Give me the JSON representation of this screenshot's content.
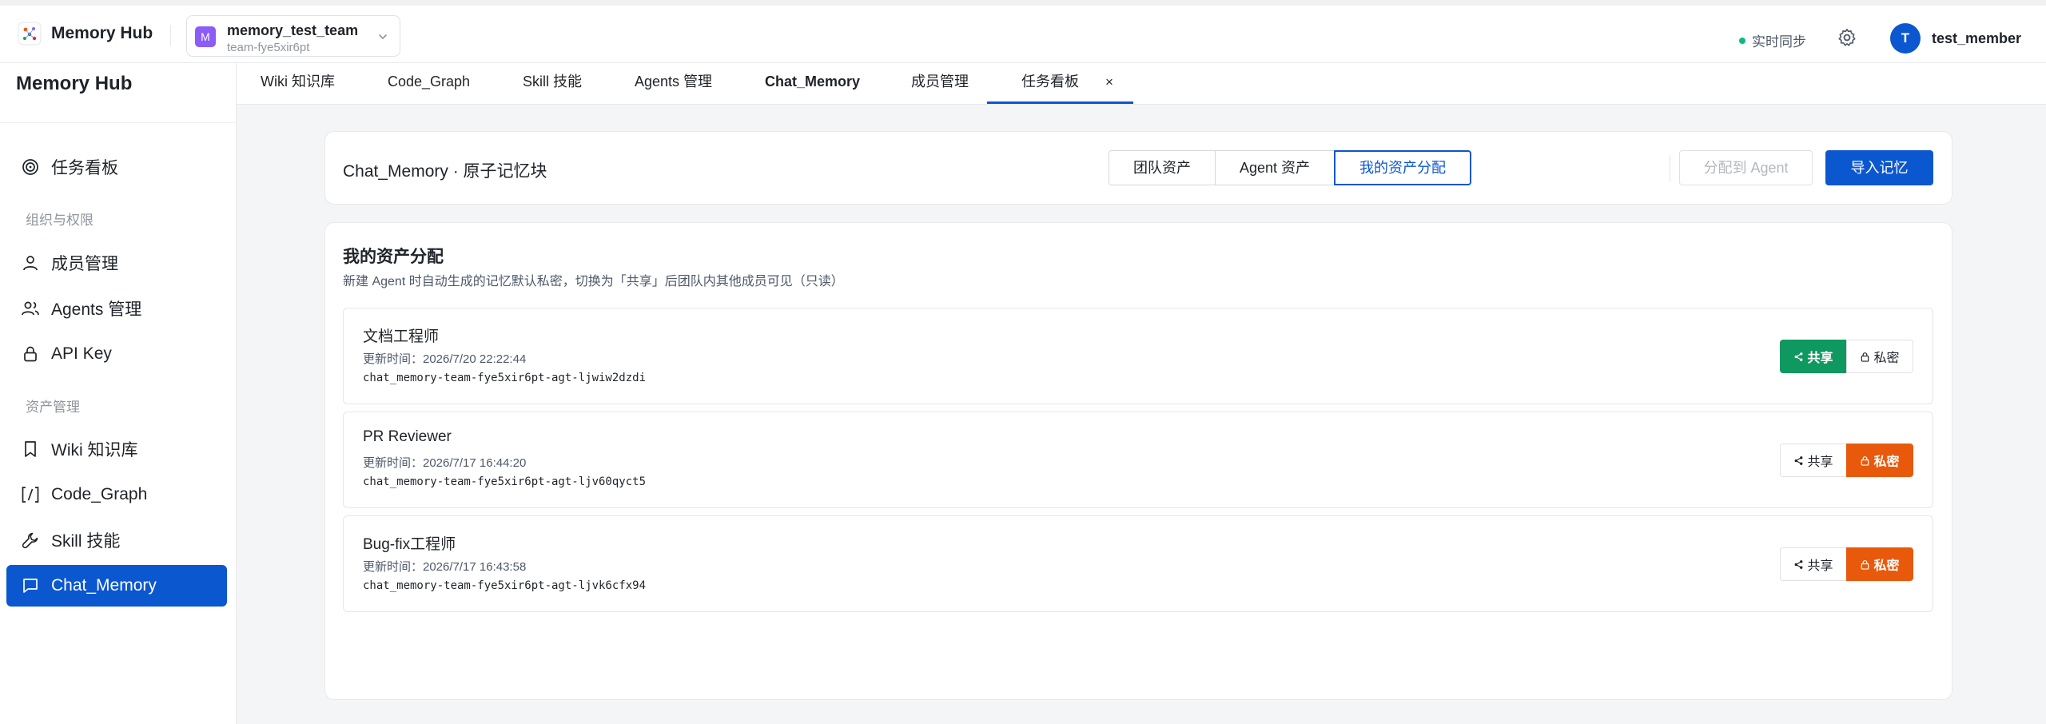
{
  "app": {
    "name": "Memory Hub"
  },
  "team": {
    "avatar_letter": "M",
    "name": "memory_test_team",
    "id": "team-fye5xir6pt"
  },
  "status": {
    "sync_label": "实时同步"
  },
  "user": {
    "avatar_letter": "T",
    "name": "test_member"
  },
  "sidebar": {
    "title": "Memory Hub",
    "items": [
      {
        "label": "任务看板"
      },
      {
        "label": "成员管理"
      },
      {
        "label": "Agents 管理"
      },
      {
        "label": "API Key"
      },
      {
        "label": "Wiki 知识库"
      },
      {
        "label": "Code_Graph"
      },
      {
        "label": "Skill 技能"
      },
      {
        "label": "Chat_Memory"
      }
    ],
    "groups": [
      "组织与权限",
      "资产管理"
    ]
  },
  "tabs": [
    {
      "label": "Wiki 知识库"
    },
    {
      "label": "Code_Graph"
    },
    {
      "label": "Skill 技能"
    },
    {
      "label": "Agents 管理"
    },
    {
      "label": "Chat_Memory",
      "close": "×"
    },
    {
      "label": "成员管理"
    },
    {
      "label": "任务看板"
    }
  ],
  "header": {
    "title": "Chat_Memory · 原子记忆块",
    "segments": [
      "团队资产",
      "Agent 资产",
      "我的资产分配"
    ],
    "active_segment": "我的资产分配",
    "assign_label": "分配到 Agent",
    "import_label": "导入记忆"
  },
  "assets": {
    "title": "我的资产分配",
    "description": "新建 Agent 时自动生成的记忆默认私密，切换为「共享」后团队内其他成员可见（只读）",
    "share_label": "共享",
    "private_label": "私密",
    "items": [
      {
        "name": "文档工程师",
        "updated": "更新时间：2026/7/20 22:22:44",
        "id": "chat_memory-team-fye5xir6pt-agt-ljwiw2dzdi",
        "visibility": "共享"
      },
      {
        "name": "PR Reviewer",
        "updated": "更新时间：2026/7/17 16:44:20",
        "id": "chat_memory-team-fye5xir6pt-agt-ljv60qyct5",
        "visibility": "私密"
      },
      {
        "name": "Bug-fix工程师",
        "updated": "更新时间：2026/7/17 16:43:58",
        "id": "chat_memory-team-fye5xir6pt-agt-ljvk6cfx94",
        "visibility": "私密"
      }
    ]
  },
  "colors": {
    "primary": "#0b57d0",
    "share_on": "#0f9960",
    "private_on": "#e8590c",
    "sync_dot": "#10b981",
    "team_avatar": "#8b5cf6"
  }
}
